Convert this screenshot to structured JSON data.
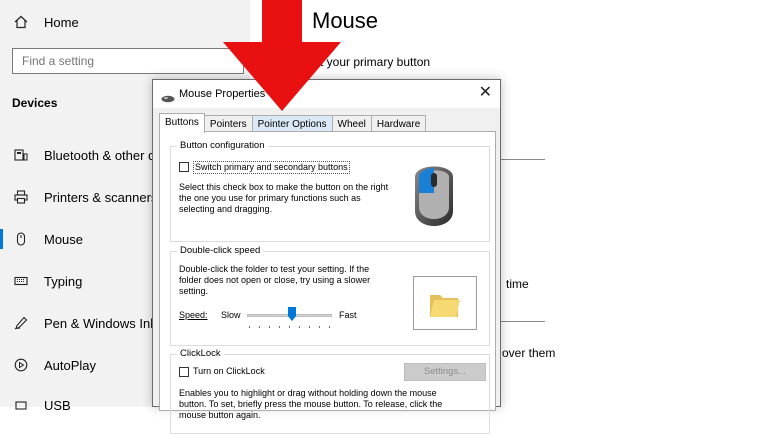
{
  "sidebar": {
    "home_label": "Home",
    "search_placeholder": "Find a setting",
    "section": "Devices",
    "items": [
      {
        "label": "Bluetooth & other de",
        "icon": "bluetooth-icon"
      },
      {
        "label": "Printers & scanners",
        "icon": "printer-icon"
      },
      {
        "label": "Mouse",
        "icon": "mouse-icon",
        "active": true
      },
      {
        "label": "Typing",
        "icon": "keyboard-icon"
      },
      {
        "label": "Pen & Windows Ink",
        "icon": "pen-icon"
      },
      {
        "label": "AutoPlay",
        "icon": "autoplay-icon"
      },
      {
        "label": "USB",
        "icon": "usb-icon"
      }
    ]
  },
  "main": {
    "title": "Mouse",
    "primary_button_text": "t your primary button",
    "time_text": "time",
    "over_them_text": "over them"
  },
  "dialog": {
    "title": "Mouse Properties",
    "close_glyph": "✕",
    "tabs": [
      "Buttons",
      "Pointers",
      "Pointer Options",
      "Wheel",
      "Hardware"
    ],
    "active_tab": "Buttons",
    "button_config": {
      "legend": "Button configuration",
      "checkbox_label": "Switch primary and secondary buttons",
      "checked": false,
      "description": "Select this check box to make the button on the right the one you use for primary functions such as selecting and dragging."
    },
    "double_click": {
      "legend": "Double-click speed",
      "description": "Double-click the folder to test your setting. If the folder does not open or close, try using a slower setting.",
      "speed_label": "Speed:",
      "slow_label": "Slow",
      "fast_label": "Fast",
      "slider_value": 0.5
    },
    "clicklock": {
      "legend": "ClickLock",
      "checkbox_label": "Turn on ClickLock",
      "checked": false,
      "settings_button": "Settings...",
      "description": "Enables you to highlight or drag without holding down the mouse button. To set, briefly press the mouse button. To release, click the mouse button again."
    }
  },
  "colors": {
    "accent": "#0078d7",
    "arrow": "#e81010",
    "sidebar_bg": "#f2f2f2"
  }
}
